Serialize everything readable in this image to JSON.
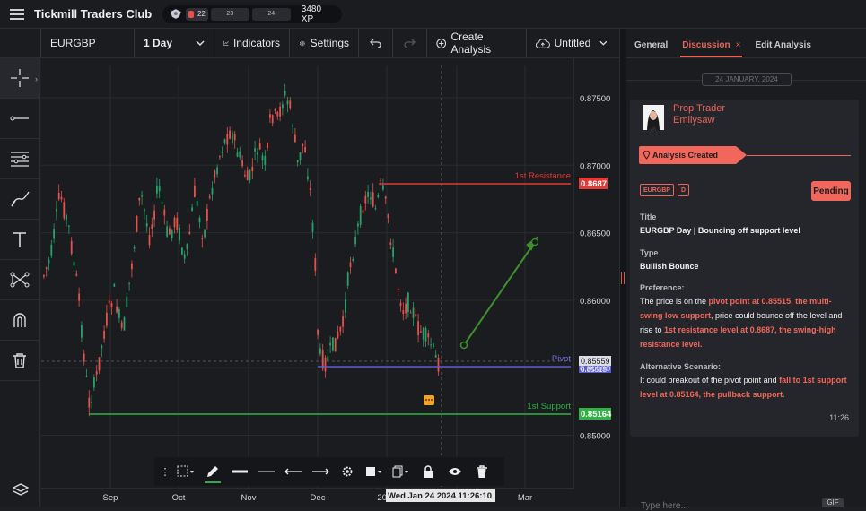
{
  "app": {
    "brand": "Tickmill Traders Club",
    "level_values": [
      "22",
      "23",
      "24"
    ],
    "xp": "3480 XP"
  },
  "toolbar": {
    "symbol": "EURGBP",
    "timeframe": "1 Day",
    "indicators": "Indicators",
    "settings": "Settings",
    "create_analysis": "Create Analysis",
    "layout_name": "Untitled"
  },
  "chart": {
    "price_ticks": [
      "0.87500",
      "0.87000",
      "0.86500",
      "0.86000",
      "0.85500",
      "0.85000"
    ],
    "time_ticks": [
      "Sep",
      "Oct",
      "Nov",
      "Dec",
      "2024",
      "Feb",
      "Mar"
    ],
    "resistance_label": "1st Resistance",
    "resistance_value": "0.8687",
    "pivot_label": "Pivot",
    "pivot_value": "0.85515",
    "current_price": "0.85559",
    "support_label": "1st Support",
    "support_value": "0.85164",
    "crosshair_time": "Wed Jan 24 2024 11:26:10"
  },
  "colors": {
    "up": "#26a269",
    "down": "#e8504a",
    "resistance": "#e03b36",
    "pivot": "#5b5bd6",
    "support": "#2fb344",
    "arrow": "#3f8f2f",
    "accent": "#e8655a"
  },
  "tabs": {
    "general": "General",
    "discussion": "Discussion",
    "edit": "Edit Analysis"
  },
  "post": {
    "date": "24 JANUARY, 2024",
    "user_role": "Prop Trader",
    "user_name": "Emilysaw",
    "status_event": "Analysis Created",
    "tag_symbol": "EURGBP",
    "tag_tf": "D",
    "status": "Pending",
    "title_label": "Title",
    "title_value": "EURGBP Day | Bouncing off support level",
    "type_label": "Type",
    "type_value": "Bullish Bounce",
    "pref_label": "Preference:",
    "pref_1": "The price is on the ",
    "pref_2": "pivot point at 0.85515, the multi-swing low support",
    "pref_3": ", price could bounce off the level and rise to ",
    "pref_4": "1st resistance level at 0.8687, the swing-high resistance level.",
    "alt_label": "Alternative Scenario:",
    "alt_1": "It could breakout of the pivot point and ",
    "alt_2": "fall to 1st support level at 0.85164, the pullback support.",
    "time": "11:26"
  },
  "composer": {
    "placeholder": "Type here...",
    "gif": "GIF"
  }
}
